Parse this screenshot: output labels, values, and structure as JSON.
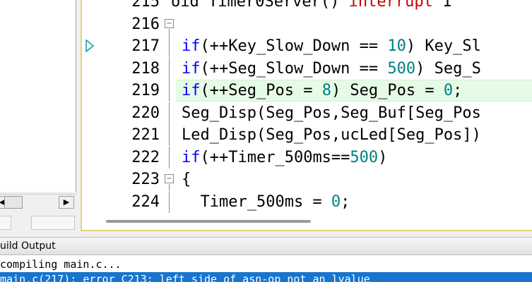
{
  "editor": {
    "lines": [
      {
        "num": "215",
        "tokens": [
          {
            "t": "oid Timer0Server() ",
            "c": ""
          },
          {
            "t": "interrupt",
            "c": "red"
          },
          {
            "t": " 1",
            "c": ""
          }
        ]
      },
      {
        "num": "216",
        "tokens": []
      },
      {
        "num": "217",
        "tokens": [
          {
            "t": "if",
            "c": "kw"
          },
          {
            "t": "(++Key_Slow_Down == ",
            "c": ""
          },
          {
            "t": "10",
            "c": "num"
          },
          {
            "t": ") Key_Sl",
            "c": ""
          }
        ]
      },
      {
        "num": "218",
        "tokens": [
          {
            "t": "if",
            "c": "kw"
          },
          {
            "t": "(++Seg_Slow_Down == ",
            "c": ""
          },
          {
            "t": "500",
            "c": "num"
          },
          {
            "t": ") Seg_S",
            "c": ""
          }
        ]
      },
      {
        "num": "219",
        "tokens": [
          {
            "t": "if",
            "c": "kw"
          },
          {
            "t": "(++Seg_Pos = ",
            "c": ""
          },
          {
            "t": "8",
            "c": "num"
          },
          {
            "t": ") Seg_Pos = ",
            "c": ""
          },
          {
            "t": "0",
            "c": "num"
          },
          {
            "t": ";",
            "c": ""
          }
        ]
      },
      {
        "num": "220",
        "tokens": [
          {
            "t": "Seg_Disp(Seg_Pos,Seg_Buf[Seg_Pos",
            "c": ""
          }
        ]
      },
      {
        "num": "221",
        "tokens": [
          {
            "t": "Led_Disp(Seg_Pos,ucLed[Seg_Pos])",
            "c": ""
          }
        ]
      },
      {
        "num": "222",
        "tokens": [
          {
            "t": "if",
            "c": "kw"
          },
          {
            "t": "(++Timer_500ms==",
            "c": ""
          },
          {
            "t": "500",
            "c": "num"
          },
          {
            "t": ")",
            "c": ""
          }
        ]
      },
      {
        "num": "223",
        "tokens": [
          {
            "t": "{",
            "c": ""
          }
        ]
      },
      {
        "num": "224",
        "tokens": [
          {
            "t": "  Timer_500ms = ",
            "c": ""
          },
          {
            "t": "0",
            "c": "num"
          },
          {
            "t": ";",
            "c": ""
          }
        ]
      }
    ],
    "highlight_line": "219",
    "current_line_marker": "217",
    "fold_lines": [
      "216",
      "223"
    ]
  },
  "left_panel": {
    "scroll_left_arrow": "◀",
    "scroll_right_arrow": "▶"
  },
  "build_output": {
    "title": "uild Output",
    "lines": [
      {
        "text": "compiling main.c...",
        "selected": false
      },
      {
        "text": "main.c(217): error C213: left side of asn-op not an lvalue",
        "selected": true
      }
    ]
  },
  "colors": {
    "keyword": "#0000ff",
    "number": "#008080",
    "interrupt": "#c00000",
    "highlight": "#e6fbe6",
    "selection": "#1874cd"
  }
}
